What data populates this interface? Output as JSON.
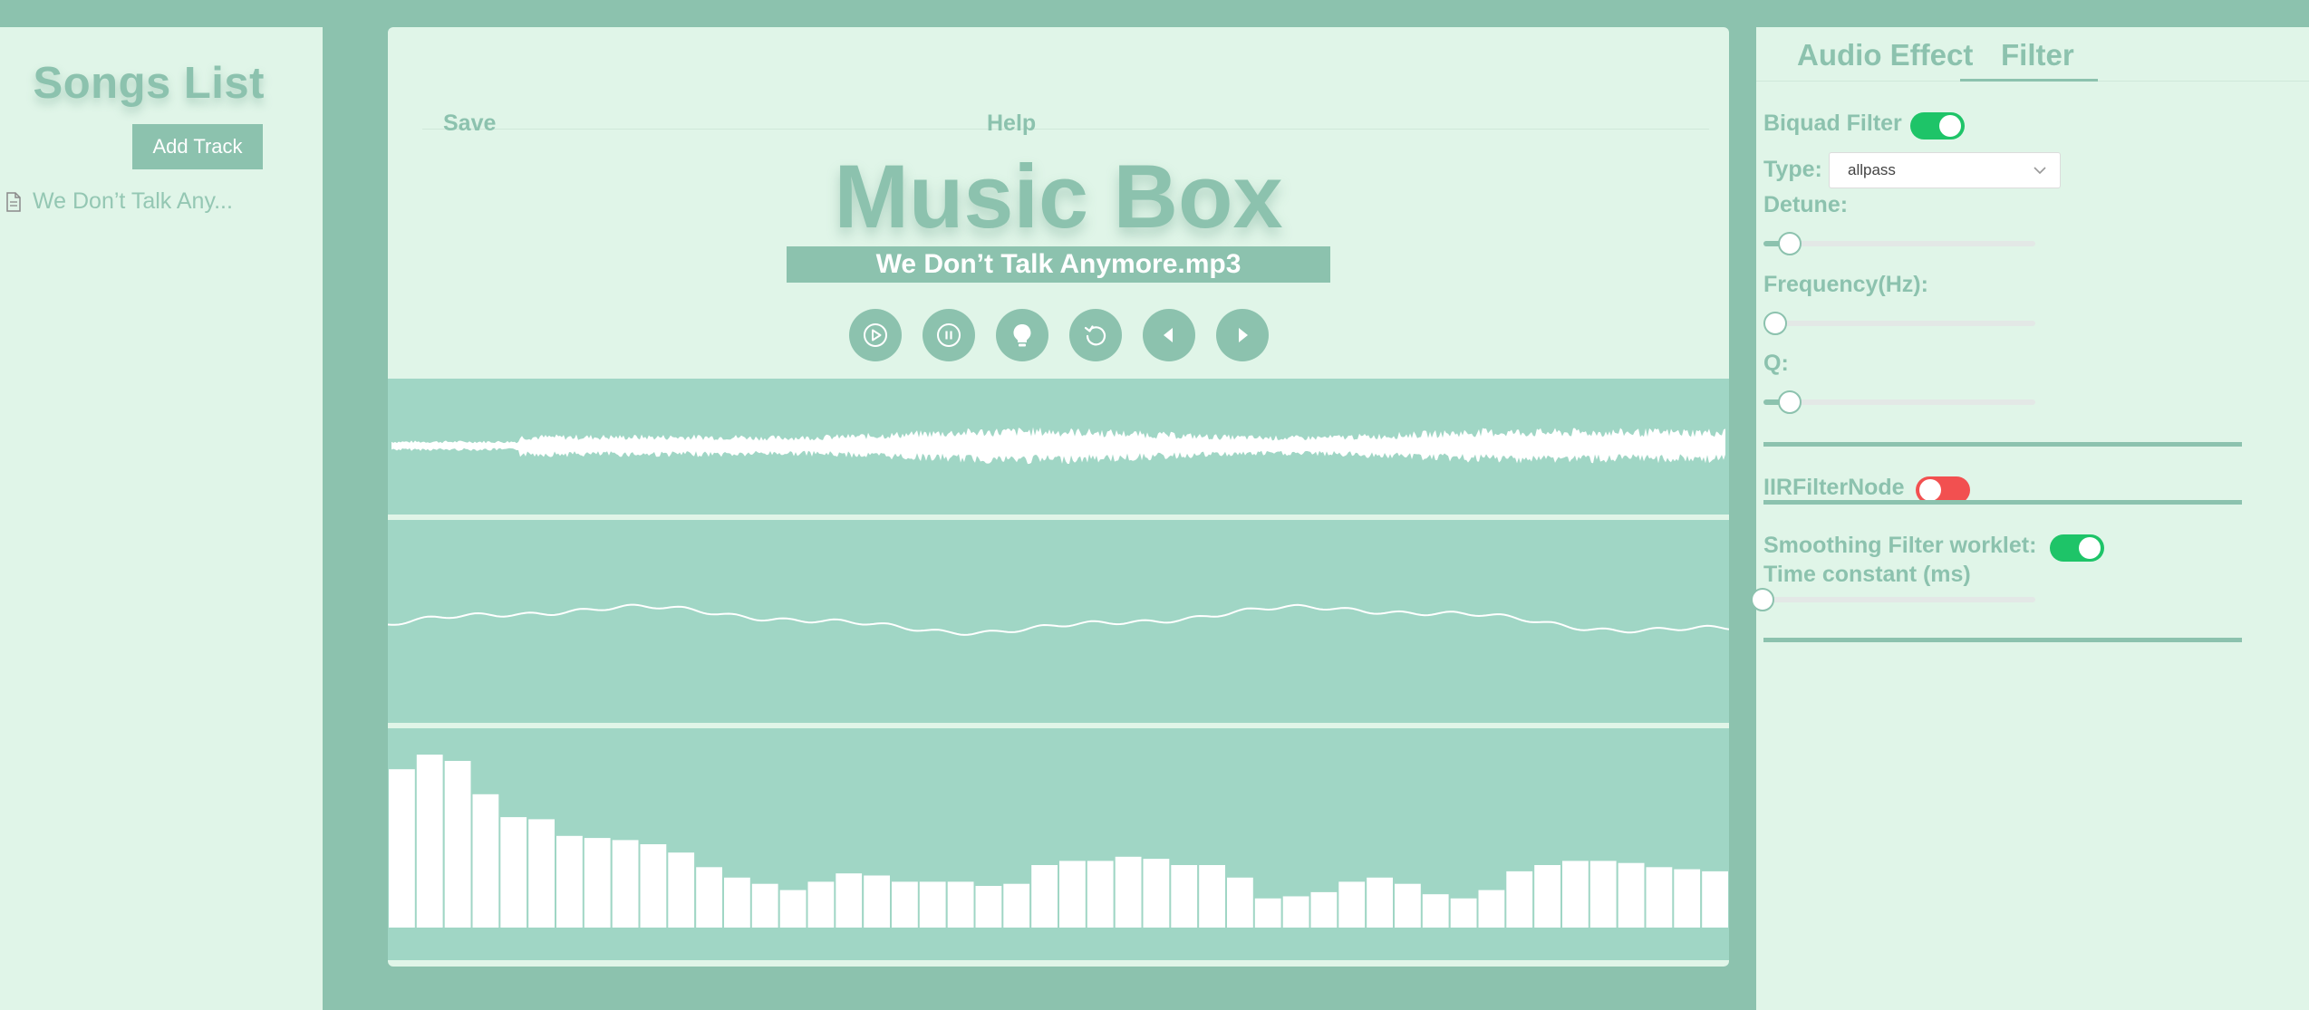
{
  "sidebar": {
    "title": "Songs List",
    "add_track_label": "Add Track",
    "tracks": [
      {
        "label": "We Don’t Talk Any..."
      }
    ]
  },
  "menu": {
    "save_label": "Save",
    "help_label": "Help"
  },
  "app": {
    "title": "Music Box",
    "now_playing": "We Don’t Talk Anymore.mp3"
  },
  "controls": [
    {
      "name": "play-button",
      "icon": "play-circle-icon"
    },
    {
      "name": "pause-button",
      "icon": "pause-circle-icon"
    },
    {
      "name": "bulb-button",
      "icon": "bulb-icon"
    },
    {
      "name": "replay-button",
      "icon": "replay-icon"
    },
    {
      "name": "previous-button",
      "icon": "caret-left-icon"
    },
    {
      "name": "next-button",
      "icon": "caret-right-icon"
    }
  ],
  "visualizer": {
    "bar_levels": [
      0.76,
      0.83,
      0.8,
      0.64,
      0.53,
      0.52,
      0.44,
      0.43,
      0.42,
      0.4,
      0.36,
      0.29,
      0.24,
      0.21,
      0.18,
      0.22,
      0.26,
      0.25,
      0.22,
      0.22,
      0.22,
      0.2,
      0.21,
      0.3,
      0.32,
      0.32,
      0.34,
      0.33,
      0.3,
      0.3,
      0.24,
      0.14,
      0.15,
      0.17,
      0.22,
      0.24,
      0.21,
      0.16,
      0.14,
      0.18,
      0.27,
      0.3,
      0.32,
      0.32,
      0.31,
      0.29,
      0.28,
      0.27
    ]
  },
  "right_panel": {
    "tabs": [
      {
        "label": "Audio Effect",
        "active": false
      },
      {
        "label": "Filter",
        "active": true
      }
    ],
    "biquad": {
      "label": "Biquad Filter",
      "enabled": true,
      "type_label": "Type:",
      "type_value": "allpass",
      "detune_label": "Detune:",
      "detune_level": 0.06,
      "frequency_label": "Frequency(Hz):",
      "frequency_level": 0.0,
      "q_label": "Q:",
      "q_level": 0.06
    },
    "iir": {
      "label": "IIRFilterNode",
      "enabled": false
    },
    "smoothing": {
      "label": "Smoothing Filter worklet:",
      "enabled": true,
      "time_constant_label": "Time constant (ms)",
      "time_constant_level": 0.0
    }
  },
  "colors": {
    "background": "#8cc2ae",
    "panel": "#e0f5e8",
    "accent": "#8cc2ae",
    "visualizer": "#a0d6c5",
    "toggle_on": "#1ec468",
    "toggle_off": "#f25050"
  }
}
